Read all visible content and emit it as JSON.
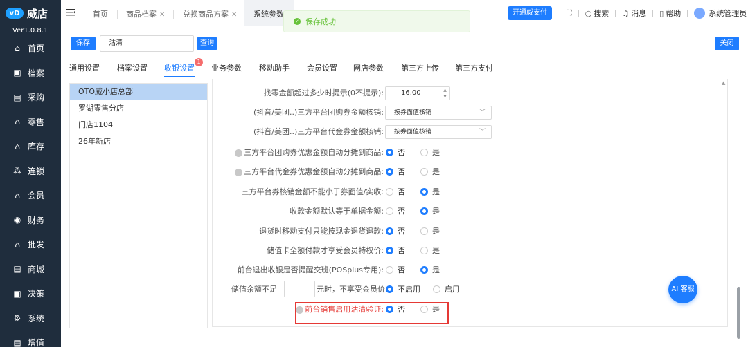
{
  "app": {
    "name": "威店",
    "logo_mark": "vD",
    "version": "Ver1.0.8.1"
  },
  "sidebar": {
    "items": [
      {
        "label": "首页",
        "icon": "home-icon"
      },
      {
        "label": "档案",
        "icon": "archive-icon"
      },
      {
        "label": "采购",
        "icon": "purchase-icon"
      },
      {
        "label": "零售",
        "icon": "retail-icon"
      },
      {
        "label": "库存",
        "icon": "inventory-icon"
      },
      {
        "label": "连锁",
        "icon": "chain-icon"
      },
      {
        "label": "会员",
        "icon": "member-icon"
      },
      {
        "label": "财务",
        "icon": "finance-icon"
      },
      {
        "label": "批发",
        "icon": "wholesale-icon"
      },
      {
        "label": "商城",
        "icon": "mall-icon"
      },
      {
        "label": "决策",
        "icon": "decision-icon"
      },
      {
        "label": "系统",
        "icon": "system-icon"
      },
      {
        "label": "增值",
        "icon": "value-added-icon"
      }
    ]
  },
  "tabs": [
    {
      "label": "首页",
      "closable": false
    },
    {
      "label": "商品档案",
      "closable": true
    },
    {
      "label": "兑换商品方案",
      "closable": true
    },
    {
      "label": "系统参数",
      "closable": false
    }
  ],
  "toast": {
    "text": "保存成功"
  },
  "header": {
    "open_pay": "开通威支付",
    "search": "搜索",
    "messages": "消息",
    "help": "帮助",
    "user": "系统管理员"
  },
  "toolbar": {
    "save": "保存",
    "search_value": "沽清",
    "query": "查询",
    "close": "关闭"
  },
  "settings_tabs": {
    "items": [
      "通用设置",
      "档案设置",
      "收银设置",
      "业务参数",
      "移动助手",
      "会员设置",
      "网店参数",
      "第三方上传",
      "第三方支付"
    ],
    "active": "收银设置",
    "badge": "1"
  },
  "stores": {
    "items": [
      "OTO威小店总部",
      "罗湖零售分店",
      "门店1104",
      "26年新店"
    ],
    "selected": "OTO威小店总部"
  },
  "form": {
    "change_prompt": {
      "label": "找零金额超过多少时提示(0不提示):",
      "value": "16.00"
    },
    "group_coupon_writeoff": {
      "label": "(抖音/美团..)三方平台团购券金额核销:",
      "value": "按券面值核销"
    },
    "voucher_writeoff": {
      "label": "(抖音/美团..)三方平台代金券金额核销:",
      "value": "按券面值核销"
    },
    "rows": [
      {
        "label": "三方平台团购券优惠金额自动分摊到商品:",
        "help": true,
        "options": [
          "否",
          "是"
        ],
        "selected": "否"
      },
      {
        "label": "三方平台代金券优惠金额自动分摊到商品:",
        "help": true,
        "options": [
          "否",
          "是"
        ],
        "selected": "否"
      },
      {
        "label": "三方平台券核销金额不能小于券面值/实收:",
        "help": false,
        "options": [
          "否",
          "是"
        ],
        "selected": "是"
      },
      {
        "label": "收款金额默认等于单据金额:",
        "help": false,
        "options": [
          "否",
          "是"
        ],
        "selected": "是"
      },
      {
        "label": "退货时移动支付只能按现金退货退款:",
        "help": false,
        "options": [
          "否",
          "是"
        ],
        "selected": "否"
      },
      {
        "label": "储值卡全额付款才享受会员特权价:",
        "help": false,
        "options": [
          "否",
          "是"
        ],
        "selected": "否"
      },
      {
        "label": "前台退出收银是否提醒交班(POSplus专用):",
        "help": false,
        "options": [
          "否",
          "是"
        ],
        "selected": "是"
      }
    ],
    "balance": {
      "prefix": "储值余额不足",
      "suffix": "元时，不享受会员价:",
      "value": "",
      "options": [
        "不启用",
        "启用"
      ],
      "selected": "不启用"
    },
    "sellout_check": {
      "label": "前台销售启用沽清验证:",
      "options": [
        "否",
        "是"
      ],
      "selected": "否"
    }
  },
  "ai_button": "AI 客服",
  "colors": {
    "primary": "#1e7dff",
    "sidebar": "#1f2d3d",
    "danger": "#e53935",
    "success": "#67c23a"
  }
}
